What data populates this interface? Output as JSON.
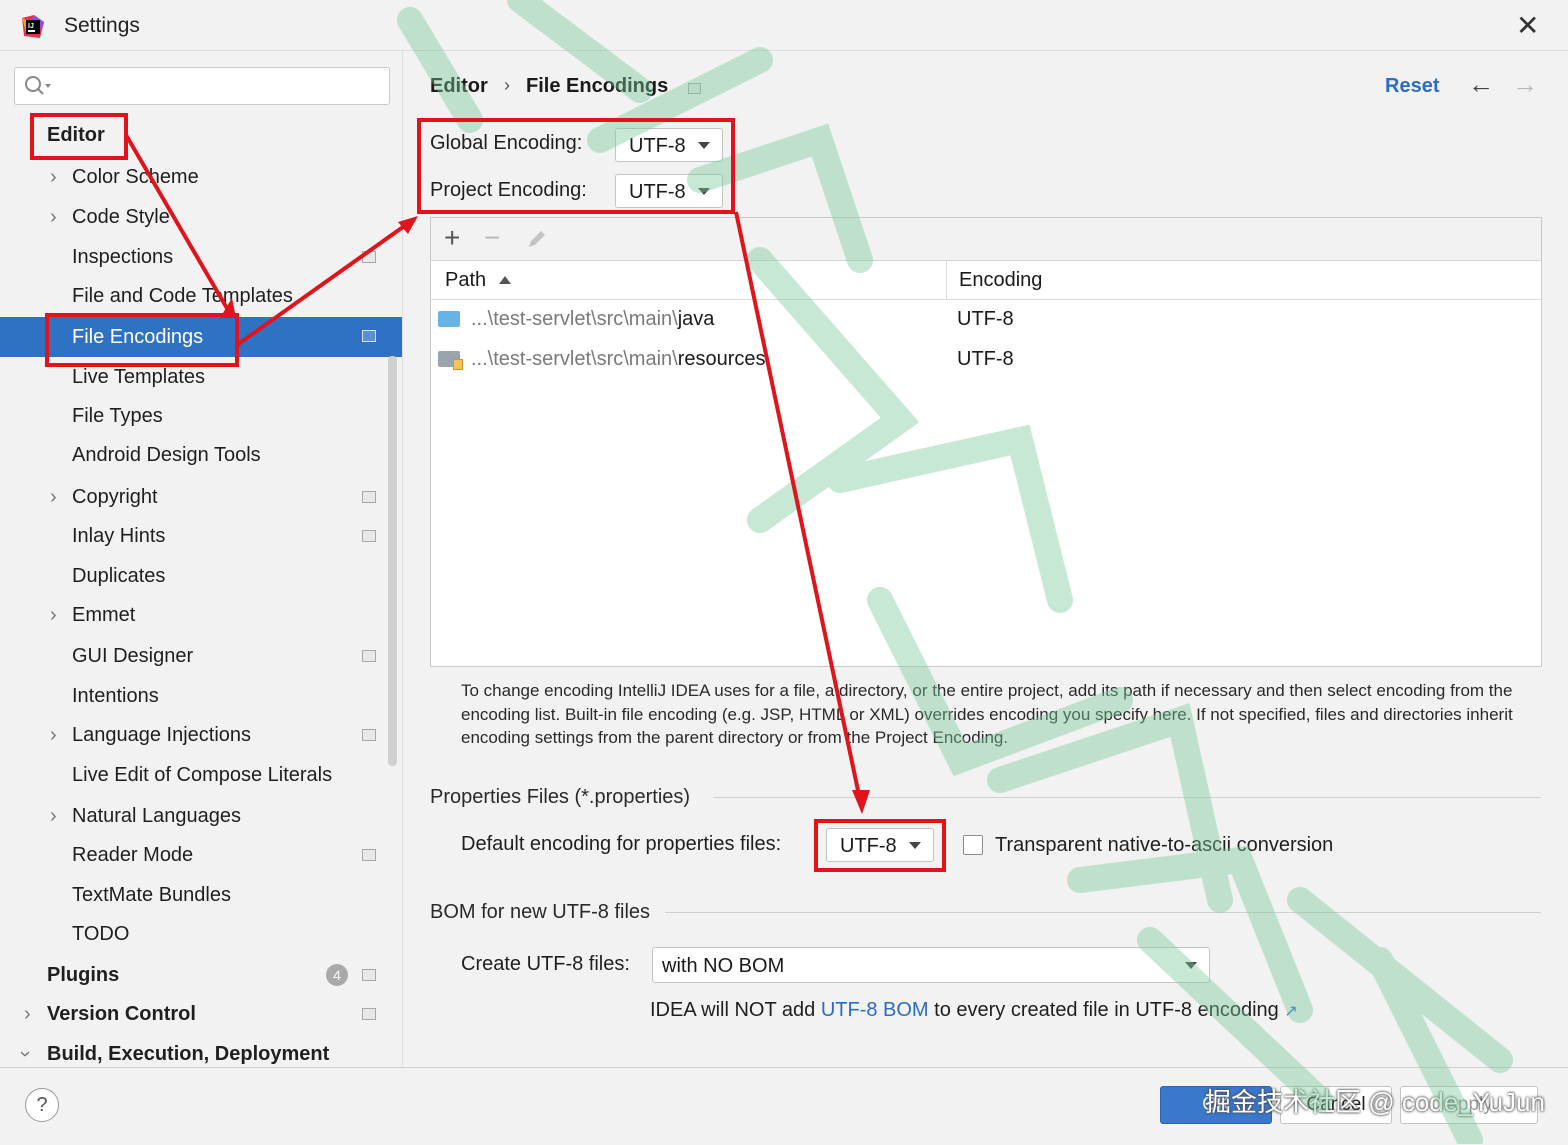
{
  "window": {
    "title": "Settings"
  },
  "search": {
    "placeholder": ""
  },
  "sidebar": {
    "items": [
      {
        "label": "Editor"
      },
      {
        "label": "Color Scheme"
      },
      {
        "label": "Code Style"
      },
      {
        "label": "Inspections"
      },
      {
        "label": "File and Code Templates"
      },
      {
        "label": "File Encodings"
      },
      {
        "label": "Live Templates"
      },
      {
        "label": "File Types"
      },
      {
        "label": "Android Design Tools"
      },
      {
        "label": "Copyright"
      },
      {
        "label": "Inlay Hints"
      },
      {
        "label": "Duplicates"
      },
      {
        "label": "Emmet"
      },
      {
        "label": "GUI Designer"
      },
      {
        "label": "Intentions"
      },
      {
        "label": "Language Injections"
      },
      {
        "label": "Live Edit of Compose Literals"
      },
      {
        "label": "Natural Languages"
      },
      {
        "label": "Reader Mode"
      },
      {
        "label": "TextMate Bundles"
      },
      {
        "label": "TODO"
      },
      {
        "label": "Plugins",
        "badge": "4"
      },
      {
        "label": "Version Control"
      },
      {
        "label": "Build, Execution, Deployment"
      }
    ],
    "selected": "File Encodings"
  },
  "breadcrumb": {
    "parent": "Editor",
    "current": "File Encodings"
  },
  "header": {
    "reset_label": "Reset"
  },
  "encodings": {
    "global_label": "Global Encoding:",
    "global_value": "UTF-8",
    "project_label": "Project Encoding:",
    "project_value": "UTF-8"
  },
  "table": {
    "columns": [
      "Path",
      "Encoding"
    ],
    "rows": [
      {
        "path_prefix": "...\\test-servlet\\src\\main\\",
        "path_name": "java",
        "encoding": "UTF-8",
        "icon": "source-folder-icon"
      },
      {
        "path_prefix": "...\\test-servlet\\src\\main\\",
        "path_name": "resources",
        "encoding": "UTF-8",
        "icon": "resources-folder-icon"
      }
    ]
  },
  "info_text": "To change encoding IntelliJ IDEA uses for a file, a directory, or the entire project, add its path if necessary and then select encoding from the encoding list. Built-in file encoding (e.g. JSP, HTML or XML) overrides encoding you specify here. If not specified, files and directories inherit encoding settings from the parent directory or from the Project Encoding.",
  "properties": {
    "section_title": "Properties Files (*.properties)",
    "default_label": "Default encoding for properties files:",
    "default_value": "UTF-8",
    "transparent_label": "Transparent native-to-ascii conversion",
    "transparent_checked": false
  },
  "bom": {
    "section_title": "BOM for new UTF-8 files",
    "create_label": "Create UTF-8 files:",
    "create_value": "with NO BOM",
    "note_prefix": "IDEA will NOT add ",
    "note_link": "UTF-8 BOM",
    "note_suffix": " to every created file in UTF-8 encoding"
  },
  "footer": {
    "ok_label": "OK",
    "cancel_label": "Cancel",
    "apply_label": "Apply",
    "credit": "掘金技术社区 @ code_YuJun"
  },
  "colors": {
    "accent": "#2f72c4",
    "link": "#2b6cc4",
    "annotation": "#e0141a",
    "watermark": "#79c99a"
  }
}
